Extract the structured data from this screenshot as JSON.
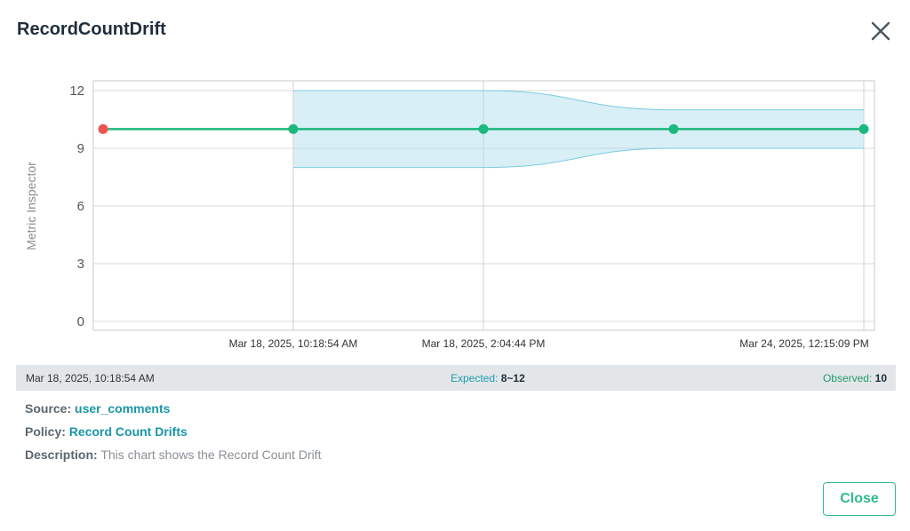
{
  "dialog": {
    "title": "RecordCountDrift",
    "close_button_label": "Close"
  },
  "chart_data": {
    "type": "line",
    "ylabel": "Metric Inspector",
    "ylim": [
      0,
      12
    ],
    "yticks": [
      0,
      3,
      6,
      9,
      12
    ],
    "x_tick_labels": [
      "Mar 18, 2025, 10:18:54 AM",
      "Mar 18, 2025, 2:04:44 PM",
      "Mar 24, 2025, 12:15:09 PM"
    ],
    "series": [
      {
        "values": [
          10,
          10,
          10,
          10,
          10
        ],
        "color": "#1db87e"
      }
    ],
    "point_colors": [
      "#f0534f",
      "#1db87e",
      "#1db87e",
      "#1db87e",
      "#1db87e"
    ],
    "band": {
      "lower": [
        null,
        8,
        8,
        9,
        9
      ],
      "upper": [
        null,
        12,
        12,
        11,
        11
      ],
      "color": "#a8dcea"
    },
    "grid": true
  },
  "summary": {
    "time": "Mar 18, 2025, 10:18:54 AM",
    "expected_label": "Expected:",
    "expected_value": "8~12",
    "observed_label": "Observed:",
    "observed_value": "10"
  },
  "info": {
    "source_label": "Source:",
    "source_value": "user_comments",
    "policy_label": "Policy:",
    "policy_value": "Record Count Drifts",
    "description_label": "Description:",
    "description_value": "This chart shows the Record Count Drift"
  },
  "colors": {
    "accent": "#2ebd8b",
    "link": "#1a96a8",
    "anomaly": "#f0534f"
  },
  "icons": {
    "close": "close-icon"
  }
}
